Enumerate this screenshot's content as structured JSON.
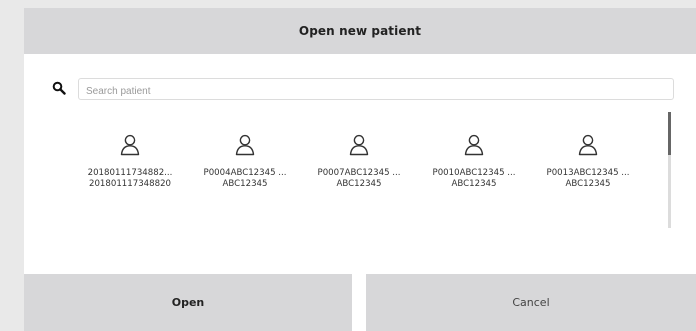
{
  "dialog": {
    "title": "Open new patient",
    "search": {
      "placeholder": "Search patient",
      "value": ""
    },
    "patients": [
      {
        "line1": "20180111734882...",
        "line2": "201801117348820"
      },
      {
        "line1": "P0004ABC12345 ...",
        "line2": "ABC12345"
      },
      {
        "line1": "P0007ABC12345 ...",
        "line2": "ABC12345"
      },
      {
        "line1": "P0010ABC12345 ...",
        "line2": "ABC12345"
      },
      {
        "line1": "P0013ABC12345 ...",
        "line2": "ABC12345"
      }
    ],
    "buttons": {
      "open": "Open",
      "cancel": "Cancel"
    }
  },
  "icons": {
    "search": "search-icon",
    "patient": "person-icon"
  },
  "colors": {
    "header_bg": "#d7d7d9",
    "button_bg": "#d7d7d9",
    "scroll_thumb": "#666666"
  }
}
